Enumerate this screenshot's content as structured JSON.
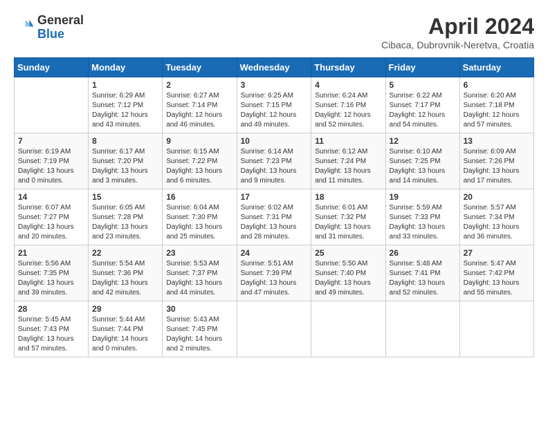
{
  "header": {
    "logo_general": "General",
    "logo_blue": "Blue",
    "month_year": "April 2024",
    "location": "Cibaca, Dubrovnik-Neretva, Croatia"
  },
  "days_of_week": [
    "Sunday",
    "Monday",
    "Tuesday",
    "Wednesday",
    "Thursday",
    "Friday",
    "Saturday"
  ],
  "weeks": [
    [
      {
        "day": "",
        "sunrise": "",
        "sunset": "",
        "daylight": ""
      },
      {
        "day": "1",
        "sunrise": "Sunrise: 6:29 AM",
        "sunset": "Sunset: 7:12 PM",
        "daylight": "Daylight: 12 hours and 43 minutes."
      },
      {
        "day": "2",
        "sunrise": "Sunrise: 6:27 AM",
        "sunset": "Sunset: 7:14 PM",
        "daylight": "Daylight: 12 hours and 46 minutes."
      },
      {
        "day": "3",
        "sunrise": "Sunrise: 6:25 AM",
        "sunset": "Sunset: 7:15 PM",
        "daylight": "Daylight: 12 hours and 49 minutes."
      },
      {
        "day": "4",
        "sunrise": "Sunrise: 6:24 AM",
        "sunset": "Sunset: 7:16 PM",
        "daylight": "Daylight: 12 hours and 52 minutes."
      },
      {
        "day": "5",
        "sunrise": "Sunrise: 6:22 AM",
        "sunset": "Sunset: 7:17 PM",
        "daylight": "Daylight: 12 hours and 54 minutes."
      },
      {
        "day": "6",
        "sunrise": "Sunrise: 6:20 AM",
        "sunset": "Sunset: 7:18 PM",
        "daylight": "Daylight: 12 hours and 57 minutes."
      }
    ],
    [
      {
        "day": "7",
        "sunrise": "Sunrise: 6:19 AM",
        "sunset": "Sunset: 7:19 PM",
        "daylight": "Daylight: 13 hours and 0 minutes."
      },
      {
        "day": "8",
        "sunrise": "Sunrise: 6:17 AM",
        "sunset": "Sunset: 7:20 PM",
        "daylight": "Daylight: 13 hours and 3 minutes."
      },
      {
        "day": "9",
        "sunrise": "Sunrise: 6:15 AM",
        "sunset": "Sunset: 7:22 PM",
        "daylight": "Daylight: 13 hours and 6 minutes."
      },
      {
        "day": "10",
        "sunrise": "Sunrise: 6:14 AM",
        "sunset": "Sunset: 7:23 PM",
        "daylight": "Daylight: 13 hours and 9 minutes."
      },
      {
        "day": "11",
        "sunrise": "Sunrise: 6:12 AM",
        "sunset": "Sunset: 7:24 PM",
        "daylight": "Daylight: 13 hours and 11 minutes."
      },
      {
        "day": "12",
        "sunrise": "Sunrise: 6:10 AM",
        "sunset": "Sunset: 7:25 PM",
        "daylight": "Daylight: 13 hours and 14 minutes."
      },
      {
        "day": "13",
        "sunrise": "Sunrise: 6:09 AM",
        "sunset": "Sunset: 7:26 PM",
        "daylight": "Daylight: 13 hours and 17 minutes."
      }
    ],
    [
      {
        "day": "14",
        "sunrise": "Sunrise: 6:07 AM",
        "sunset": "Sunset: 7:27 PM",
        "daylight": "Daylight: 13 hours and 20 minutes."
      },
      {
        "day": "15",
        "sunrise": "Sunrise: 6:05 AM",
        "sunset": "Sunset: 7:28 PM",
        "daylight": "Daylight: 13 hours and 23 minutes."
      },
      {
        "day": "16",
        "sunrise": "Sunrise: 6:04 AM",
        "sunset": "Sunset: 7:30 PM",
        "daylight": "Daylight: 13 hours and 25 minutes."
      },
      {
        "day": "17",
        "sunrise": "Sunrise: 6:02 AM",
        "sunset": "Sunset: 7:31 PM",
        "daylight": "Daylight: 13 hours and 28 minutes."
      },
      {
        "day": "18",
        "sunrise": "Sunrise: 6:01 AM",
        "sunset": "Sunset: 7:32 PM",
        "daylight": "Daylight: 13 hours and 31 minutes."
      },
      {
        "day": "19",
        "sunrise": "Sunrise: 5:59 AM",
        "sunset": "Sunset: 7:33 PM",
        "daylight": "Daylight: 13 hours and 33 minutes."
      },
      {
        "day": "20",
        "sunrise": "Sunrise: 5:57 AM",
        "sunset": "Sunset: 7:34 PM",
        "daylight": "Daylight: 13 hours and 36 minutes."
      }
    ],
    [
      {
        "day": "21",
        "sunrise": "Sunrise: 5:56 AM",
        "sunset": "Sunset: 7:35 PM",
        "daylight": "Daylight: 13 hours and 39 minutes."
      },
      {
        "day": "22",
        "sunrise": "Sunrise: 5:54 AM",
        "sunset": "Sunset: 7:36 PM",
        "daylight": "Daylight: 13 hours and 42 minutes."
      },
      {
        "day": "23",
        "sunrise": "Sunrise: 5:53 AM",
        "sunset": "Sunset: 7:37 PM",
        "daylight": "Daylight: 13 hours and 44 minutes."
      },
      {
        "day": "24",
        "sunrise": "Sunrise: 5:51 AM",
        "sunset": "Sunset: 7:39 PM",
        "daylight": "Daylight: 13 hours and 47 minutes."
      },
      {
        "day": "25",
        "sunrise": "Sunrise: 5:50 AM",
        "sunset": "Sunset: 7:40 PM",
        "daylight": "Daylight: 13 hours and 49 minutes."
      },
      {
        "day": "26",
        "sunrise": "Sunrise: 5:48 AM",
        "sunset": "Sunset: 7:41 PM",
        "daylight": "Daylight: 13 hours and 52 minutes."
      },
      {
        "day": "27",
        "sunrise": "Sunrise: 5:47 AM",
        "sunset": "Sunset: 7:42 PM",
        "daylight": "Daylight: 13 hours and 55 minutes."
      }
    ],
    [
      {
        "day": "28",
        "sunrise": "Sunrise: 5:45 AM",
        "sunset": "Sunset: 7:43 PM",
        "daylight": "Daylight: 13 hours and 57 minutes."
      },
      {
        "day": "29",
        "sunrise": "Sunrise: 5:44 AM",
        "sunset": "Sunset: 7:44 PM",
        "daylight": "Daylight: 14 hours and 0 minutes."
      },
      {
        "day": "30",
        "sunrise": "Sunrise: 5:43 AM",
        "sunset": "Sunset: 7:45 PM",
        "daylight": "Daylight: 14 hours and 2 minutes."
      },
      {
        "day": "",
        "sunrise": "",
        "sunset": "",
        "daylight": ""
      },
      {
        "day": "",
        "sunrise": "",
        "sunset": "",
        "daylight": ""
      },
      {
        "day": "",
        "sunrise": "",
        "sunset": "",
        "daylight": ""
      },
      {
        "day": "",
        "sunrise": "",
        "sunset": "",
        "daylight": ""
      }
    ]
  ]
}
